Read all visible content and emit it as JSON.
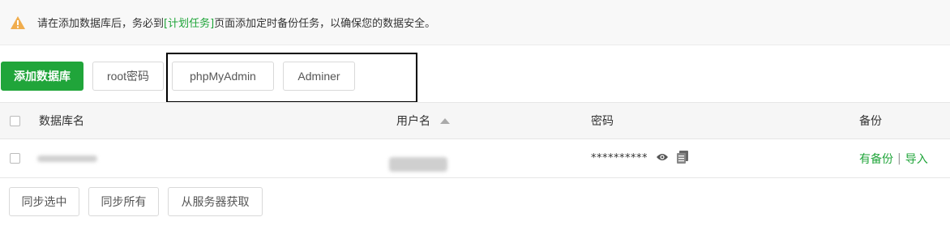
{
  "notice": {
    "text_before": "请在添加数据库后，务必到",
    "link_text": "[计划任务]",
    "text_after": "页面添加定时备份任务，以确保您的数据安全。"
  },
  "toolbar": {
    "add_db": "添加数据库",
    "root_pwd": "root密码",
    "phpmyadmin": "phpMyAdmin",
    "adminer": "Adminer"
  },
  "table": {
    "headers": {
      "db_name": "数据库名",
      "username": "用户名",
      "password": "密码",
      "backup": "备份"
    },
    "rows": [
      {
        "password": "**********",
        "backup_link": "有备份",
        "import_link": "导入",
        "separator": "|"
      }
    ]
  },
  "footer": {
    "sync_selected": "同步选中",
    "sync_all": "同步所有",
    "fetch_server": "从服务器获取"
  },
  "colors": {
    "accent": "#20a53a",
    "warning": "#f0ad4e"
  },
  "icons": [
    "warning-icon",
    "sort-asc-icon",
    "eye-icon",
    "copy-icon"
  ]
}
